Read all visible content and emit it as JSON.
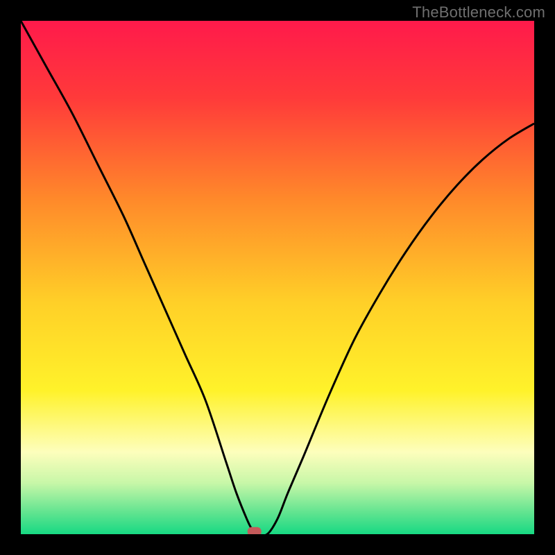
{
  "watermark": "TheBottleneck.com",
  "chart_data": {
    "type": "line",
    "title": "",
    "xlabel": "",
    "ylabel": "",
    "xlim": [
      0,
      100
    ],
    "ylim": [
      0,
      100
    ],
    "background_gradient": {
      "stops": [
        {
          "offset": 0.0,
          "color": "#ff1a4b"
        },
        {
          "offset": 0.15,
          "color": "#ff3a3a"
        },
        {
          "offset": 0.35,
          "color": "#ff8a2a"
        },
        {
          "offset": 0.55,
          "color": "#ffd028"
        },
        {
          "offset": 0.72,
          "color": "#fff22a"
        },
        {
          "offset": 0.84,
          "color": "#fdfebc"
        },
        {
          "offset": 0.9,
          "color": "#c8f7a8"
        },
        {
          "offset": 0.96,
          "color": "#5de38f"
        },
        {
          "offset": 1.0,
          "color": "#17d983"
        }
      ]
    },
    "series": [
      {
        "name": "bottleneck-curve",
        "color": "#000000",
        "x": [
          0,
          5,
          10,
          15,
          20,
          24,
          28,
          32,
          36,
          40,
          42,
          44,
          45,
          46,
          48,
          50,
          52,
          55,
          60,
          65,
          70,
          75,
          80,
          85,
          90,
          95,
          100
        ],
        "y": [
          100,
          91,
          82,
          72,
          62,
          53,
          44,
          35,
          26,
          14,
          8,
          3,
          1,
          0,
          0,
          3,
          8,
          15,
          27,
          38,
          47,
          55,
          62,
          68,
          73,
          77,
          80
        ]
      }
    ],
    "marker": {
      "name": "minimum-marker",
      "x": 45.5,
      "y": 0.5,
      "color": "#c45a5a"
    }
  }
}
